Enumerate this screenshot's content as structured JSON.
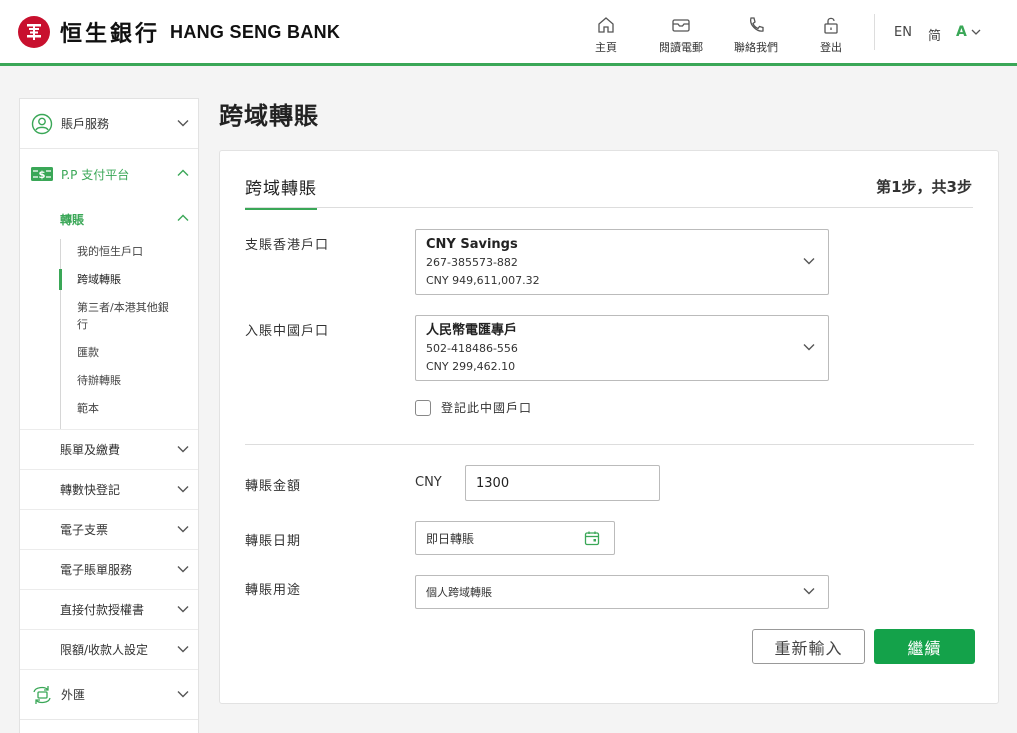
{
  "header": {
    "logo_cn": "恒生銀行",
    "logo_en": "HANG SENG BANK",
    "nav": [
      {
        "label": "主頁",
        "icon": "home-icon"
      },
      {
        "label": "閱讀電郵",
        "icon": "mail-icon"
      },
      {
        "label": "聯絡我們",
        "icon": "phone-icon"
      },
      {
        "label": "登出",
        "icon": "lock-icon"
      }
    ],
    "lang_en": "EN",
    "lang_sc": "简",
    "font_size": "A"
  },
  "sidebar": {
    "account_services": "賬戶服務",
    "payment_platform": "P.P 支付平台",
    "transfer": "轉賬",
    "transfer_items": [
      {
        "label": "我的恒生戶口"
      },
      {
        "label": "跨域轉賬"
      },
      {
        "label": "第三者/本港其他銀行"
      },
      {
        "label": "匯款"
      },
      {
        "label": "待辦轉賬"
      },
      {
        "label": "範本"
      }
    ],
    "subitems": [
      {
        "label": "賬單及繳費"
      },
      {
        "label": "轉數快登記"
      },
      {
        "label": "電子支票"
      },
      {
        "label": "電子賬單服務"
      },
      {
        "label": "直接付款授權書"
      },
      {
        "label": "限額/收款人設定"
      }
    ],
    "fx": "外匯"
  },
  "main": {
    "page_title": "跨域轉賬",
    "tab_label": "跨域轉賬",
    "step": "第1步，共3步",
    "from_label": "支賬香港戶口",
    "from_account": {
      "name": "CNY Savings",
      "number": "267-385573-882",
      "balance": "CNY 949,611,007.32"
    },
    "to_label": "入賬中國戶口",
    "to_account": {
      "name": "人民幣電匯專戶",
      "number": "502-418486-556",
      "balance": "CNY 299,462.10"
    },
    "register_label": "登記此中國戶口",
    "amount_label": "轉賬金額",
    "currency": "CNY",
    "amount_value": "1300",
    "date_label": "轉賬日期",
    "date_value": "即日轉賬",
    "purpose_label": "轉賬用途",
    "purpose_value": "個人跨域轉賬",
    "reset_button": "重新輸入",
    "continue_button": "繼續"
  },
  "colors": {
    "brand_green": "#3aa757",
    "button_green": "#14a24a",
    "logo_red": "#c8102e"
  }
}
